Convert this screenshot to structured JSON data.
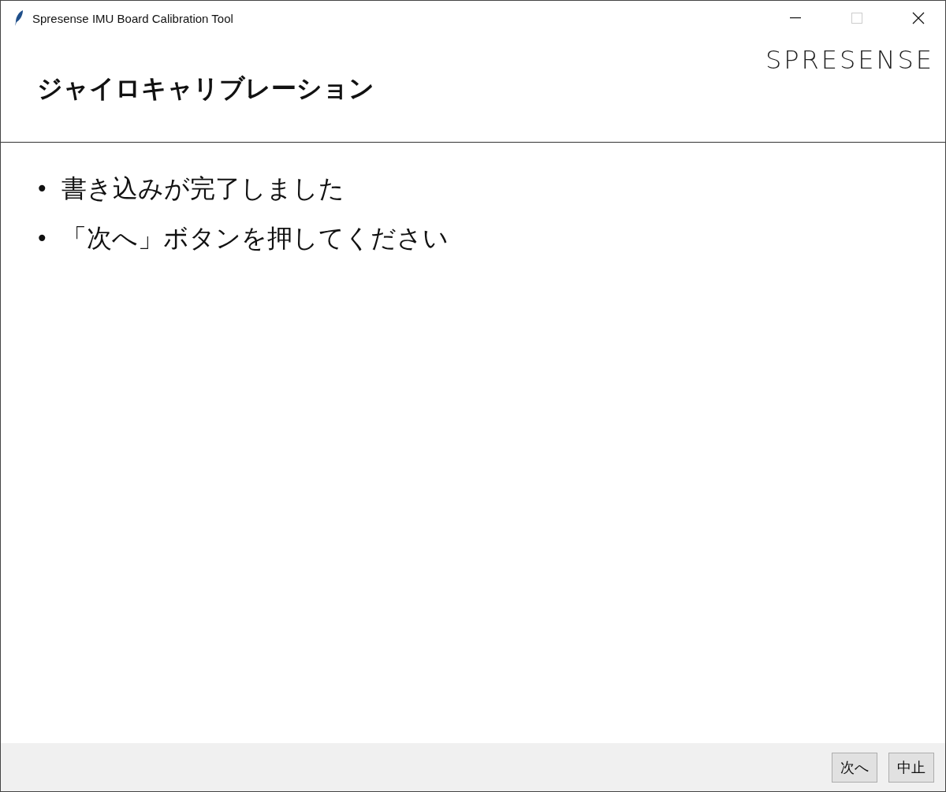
{
  "window": {
    "title": "Spresense IMU Board Calibration Tool",
    "maximize_disabled": true
  },
  "header": {
    "title": "ジャイロキャリブレーション",
    "logo": "SPRESENSE"
  },
  "bullets": [
    {
      "marker": "•",
      "text": "書き込みが完了しました"
    },
    {
      "marker": "•",
      "text": "「次へ」ボタンを押してください"
    }
  ],
  "buttons": [
    {
      "label": "次へ"
    },
    {
      "label": "中止"
    }
  ]
}
